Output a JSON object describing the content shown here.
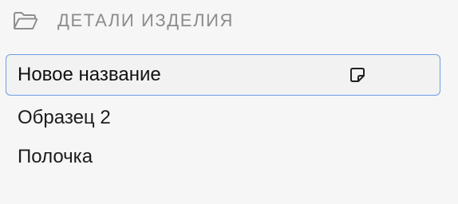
{
  "header": {
    "icon": "folder-icon",
    "title": "ДЕТАЛИ ИЗДЕЛИЯ"
  },
  "rename_field": {
    "value": "Новое название",
    "trailing_icon": "sticky-note-icon"
  },
  "items": [
    {
      "label": "Образец 2"
    },
    {
      "label": "Полочка"
    }
  ],
  "colors": {
    "background": "#f6f6f6",
    "header_text": "#8b8b8b",
    "focus_border": "#6f9ee6"
  }
}
